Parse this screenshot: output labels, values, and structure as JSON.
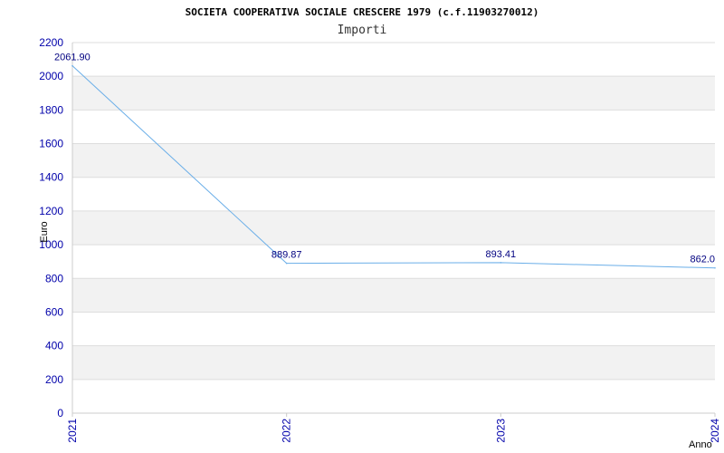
{
  "chart_data": {
    "type": "line",
    "title": "SOCIETA COOPERATIVA SOCIALE CRESCERE 1979 (c.f.11903270012)",
    "subtitle": "Importi",
    "xlabel": "Anno",
    "ylabel": "Euro",
    "categories": [
      "2021",
      "2022",
      "2023",
      "2024"
    ],
    "values": [
      2061.9,
      889.87,
      893.41,
      862.0
    ],
    "value_labels": [
      "2061.90",
      "889.87",
      "893.41",
      "862.0"
    ],
    "ylim": [
      0,
      2200
    ],
    "yticks": [
      "0",
      "200",
      "400",
      "600",
      "800",
      "1000",
      "1200",
      "1400",
      "1600",
      "1800",
      "2000",
      "2200"
    ],
    "grid": true,
    "colors": {
      "line": "#6aaee8",
      "band": "#f2f2f2",
      "tick_text": "#0000aa",
      "data_label": "#000080"
    }
  }
}
